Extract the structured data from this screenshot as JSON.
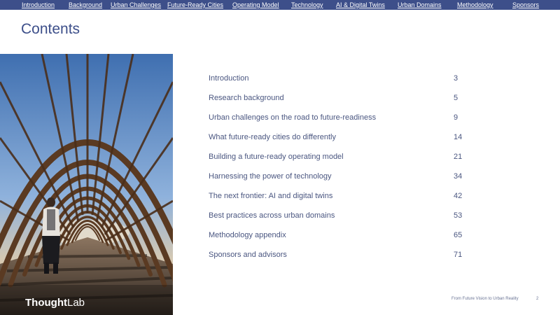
{
  "nav": {
    "items": [
      {
        "label": "Introduction"
      },
      {
        "label": "Background"
      },
      {
        "label": "Urban Challenges"
      },
      {
        "label": "Future-Ready Cities"
      },
      {
        "label": "Operating Model"
      },
      {
        "label": "Technology"
      },
      {
        "label": "AI & Digital Twins"
      },
      {
        "label": "Urban Domains"
      },
      {
        "label": "Methodology"
      },
      {
        "label": "Sponsors"
      }
    ]
  },
  "page": {
    "title": "Contents"
  },
  "logo": {
    "part1": "Thought",
    "part2": "Lab"
  },
  "toc": {
    "entries": [
      {
        "label": "Introduction",
        "page": "3"
      },
      {
        "label": "Research background",
        "page": "5"
      },
      {
        "label": "Urban challenges on the road to future-readiness",
        "page": "9"
      },
      {
        "label": "What future-ready cities do differently",
        "page": "14"
      },
      {
        "label": "Building a future-ready operating model",
        "page": "21"
      },
      {
        "label": "Harnessing the power of technology",
        "page": "34"
      },
      {
        "label": "The next frontier: AI and digital twins",
        "page": "42"
      },
      {
        "label": "Best practices across urban domains",
        "page": "53"
      },
      {
        "label": "Methodology appendix",
        "page": "65"
      },
      {
        "label": "Sponsors and advisors",
        "page": "71"
      }
    ]
  },
  "footer": {
    "text": "From Future Vision to Urban Reality",
    "page_number": "2"
  },
  "colors": {
    "nav_bg": "#3d4f8a",
    "title": "#3d4f8a",
    "toc_text": "#4a5680"
  }
}
